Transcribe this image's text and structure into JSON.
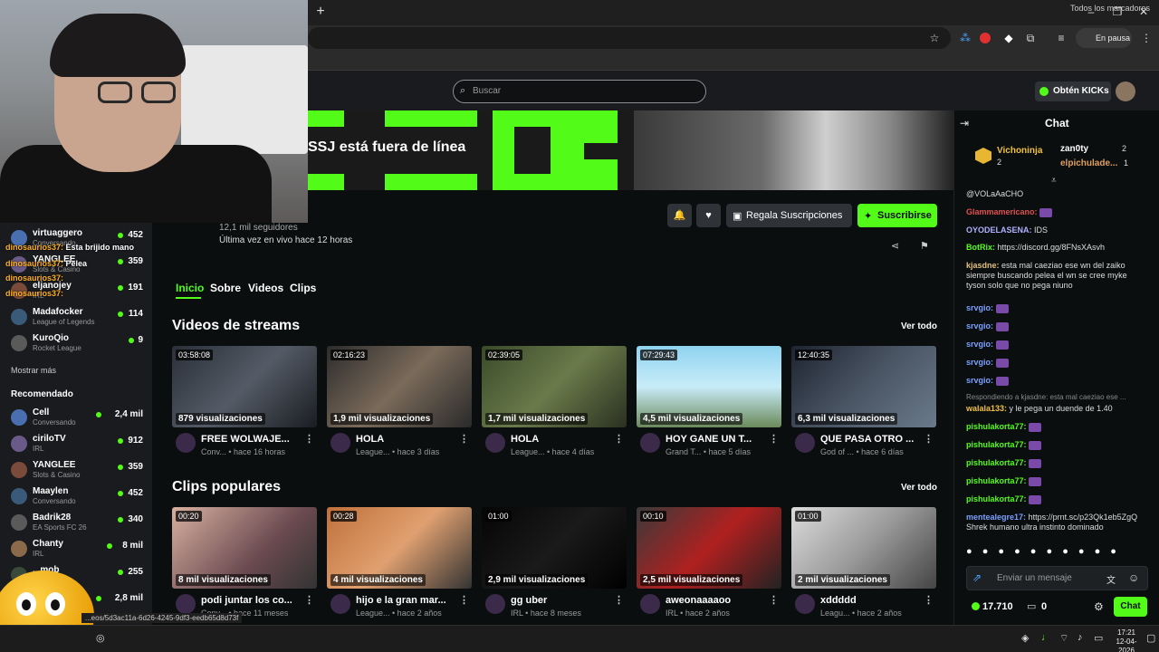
{
  "browser": {
    "new_tab": "+",
    "minimize": "–",
    "restore": "❐",
    "close": "✕",
    "pause_label": "En pausa",
    "bookmarks_all": "Todos los marcadores"
  },
  "header": {
    "search_placeholder": "Buscar",
    "kicks_button": "Obtén KICKs"
  },
  "banner": {
    "offline_text": "SSJ está fuera de línea"
  },
  "channel": {
    "followers": "12,1 mil seguidores",
    "last_live": "Última vez en vivo hace 12 horas",
    "gift_button": "Regala Suscripciones",
    "subscribe_button": "Suscribirse",
    "tabs": [
      "Inicio",
      "Sobre",
      "Videos",
      "Clips"
    ]
  },
  "videos": {
    "title": "Videos de streams",
    "see_all": "Ver todo",
    "items": [
      {
        "duration": "03:58:08",
        "views": "879 visualizaciones",
        "title": "FREE WOLWAJE...",
        "category": "Conv...",
        "age": "hace 16 horas"
      },
      {
        "duration": "02:16:23",
        "views": "1,9 mil visualizaciones",
        "title": "HOLA",
        "category": "League...",
        "age": "hace 3 días"
      },
      {
        "duration": "02:39:05",
        "views": "1,7 mil visualizaciones",
        "title": "HOLA",
        "category": "League...",
        "age": "hace 4 días"
      },
      {
        "duration": "07:29:43",
        "views": "4,5 mil visualizaciones",
        "title": "HOY GANE UN T...",
        "category": "Grand T...",
        "age": "hace 5 días"
      },
      {
        "duration": "12:40:35",
        "views": "6,3 mil visualizaciones",
        "title": "QUE PASA OTRO ...",
        "category": "God of ...",
        "age": "hace 6 días"
      }
    ]
  },
  "clips": {
    "title": "Clips populares",
    "see_all": "Ver todo",
    "items": [
      {
        "duration": "00:20",
        "views": "8 mil visualizaciones",
        "title": "podi juntar los co...",
        "category": "Conv...",
        "age": "hace 11 meses"
      },
      {
        "duration": "00:28",
        "views": "4 mil visualizaciones",
        "title": "hijo e la gran mar...",
        "category": "League...",
        "age": "hace 2 años"
      },
      {
        "duration": "01:00",
        "views": "2,9 mil visualizaciones",
        "title": "gg uber",
        "category": "IRL",
        "age": "hace 8 meses"
      },
      {
        "duration": "00:10",
        "views": "2,5 mil visualizaciones",
        "title": "aweonaaaaoo",
        "category": "IRL",
        "age": "hace 2 años"
      },
      {
        "duration": "01:00",
        "views": "2 mil visualizaciones",
        "title": "xddddd",
        "category": "Leagu...",
        "age": "hace 2 años"
      }
    ]
  },
  "sidebar": {
    "following": [
      {
        "name": "virtuaggero",
        "category": "Conversando",
        "count": "452"
      },
      {
        "name": "YANGLEE",
        "category": "Slots & Casino",
        "count": "359"
      },
      {
        "name": "eljanojey",
        "category": "IRL",
        "count": "191"
      },
      {
        "name": "Madafocker",
        "category": "League of Legends",
        "count": "114"
      },
      {
        "name": "KuroQio",
        "category": "Rocket League",
        "count": "9"
      }
    ],
    "show_more": "Mostrar más",
    "recommended_title": "Recomendado",
    "recommended": [
      {
        "name": "Cell",
        "category": "Conversando",
        "count": "2,4 mil"
      },
      {
        "name": "ciriloTV",
        "category": "IRL",
        "count": "912"
      },
      {
        "name": "YANGLEE",
        "category": "Slots & Casino",
        "count": "359"
      },
      {
        "name": "Maaylen",
        "category": "Conversando",
        "count": "452"
      },
      {
        "name": "Badrik28",
        "category": "EA Sports FC 26",
        "count": "340"
      },
      {
        "name": "Chanty",
        "category": "IRL",
        "count": "8 mil"
      },
      {
        "name": "...mob",
        "category": "",
        "count": "255"
      },
      {
        "name": "",
        "category": "",
        "count": "2,8 mil"
      }
    ]
  },
  "overlay": {
    "line1_user": "dinosaurios37:",
    "line1_text": "Esta brijido mano",
    "line2_user": "dinosaurios37:",
    "line2_text": "Pelea",
    "line3_user": "dinosaurios37:",
    "line4_user": "dinosaurios37:"
  },
  "status_url": "...eos/5d3ac11a-6d26-4245-9df3-eedb65d8d73f",
  "chat": {
    "title": "Chat",
    "leaders": [
      {
        "name": "Vichoninja",
        "count": "2"
      },
      {
        "name": "zan0ty",
        "count": "2"
      },
      {
        "name": "elpichulade...",
        "count": "1"
      }
    ],
    "messages": [
      {
        "user": "",
        "text": "@VOLaAaCHO"
      },
      {
        "user": "Glammamericano:",
        "text": ""
      },
      {
        "user": "OYODELASENA:",
        "text": "IDS"
      },
      {
        "user": "BotRix:",
        "text": "https://discord.gg/8FNsXAsvh"
      },
      {
        "user": "kjasdne:",
        "text": "esta mal caeziao ese wn del zaiko siempre buscando pelea el wn se cree myke tyson solo que no pega niuno"
      },
      {
        "user": "srvgio:",
        "text": ""
      },
      {
        "user": "srvgio:",
        "text": ""
      },
      {
        "user": "srvgio:",
        "text": ""
      },
      {
        "user": "srvgio:",
        "text": ""
      },
      {
        "user": "srvgio:",
        "text": ""
      },
      {
        "user": "",
        "text": "Respondiendo a kjasdne: esta mal caeziao ese ..."
      },
      {
        "user": "walala133:",
        "text": "y le pega un duende de 1.40"
      },
      {
        "user": "pishulakorta77:",
        "text": ""
      },
      {
        "user": "pishulakorta77:",
        "text": ""
      },
      {
        "user": "pishulakorta77:",
        "text": ""
      },
      {
        "user": "pishulakorta77:",
        "text": ""
      },
      {
        "user": "pishulakorta77:",
        "text": ""
      },
      {
        "user": "mentealegre17:",
        "text": "https://prnt.sc/p23Qk1eb5ZgQ Shrek humano ultra instinto dominado"
      }
    ],
    "input_placeholder": "Enviar un mensaje",
    "kicks_count": "17.710",
    "zero": "0",
    "send_button": "Chat"
  },
  "taskbar": {
    "time": "17:21",
    "date": "12-04-2026"
  },
  "colors": {
    "accent": "#53fc18",
    "background": "#0b0e0f",
    "panel": "#191b1f"
  }
}
